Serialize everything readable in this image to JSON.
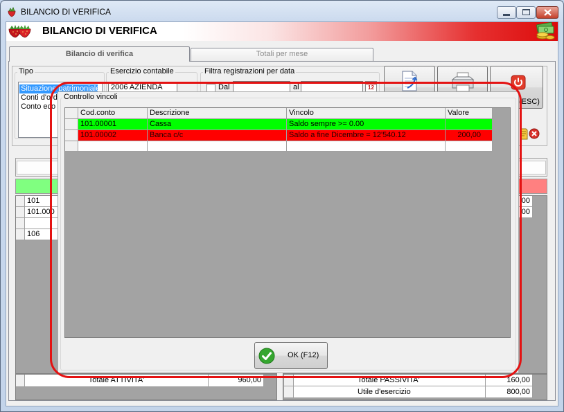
{
  "window": {
    "title": "BILANCIO DI VERIFICA"
  },
  "header": {
    "title": "BILANCIO DI VERIFICA"
  },
  "tabs": [
    {
      "label": "Bilancio di verifica",
      "active": true
    },
    {
      "label": "Totali per mese",
      "active": false
    }
  ],
  "tipo": {
    "label": "Tipo",
    "items": [
      "Situazione patrimoniale",
      "Conti d'ordi",
      "Conto eco"
    ],
    "selected_index": 0
  },
  "esercizio": {
    "label": "Esercizio contabile",
    "value": "2006 AZIENDA"
  },
  "filtro": {
    "label": "Filtra registrazioni per data",
    "dal_label": "Dal",
    "dal_checked": false,
    "dal_value": "",
    "al_label": "al",
    "al_value": "",
    "calendar_day": "12"
  },
  "toolbar": {
    "exit_label": "(ESC)"
  },
  "dialog": {
    "title": "Controllo vincoli",
    "columns": [
      "Cod.conto",
      "Descrizione",
      "Vincolo",
      "Valore"
    ],
    "rows": [
      {
        "cod": "101.00001",
        "desc": "Cassa",
        "vincolo": "Saldo sempre >= 0.00",
        "valore": "",
        "status": "ok"
      },
      {
        "cod": "101.00002",
        "desc": "Banca c/c",
        "vincolo": "Saldo a fine Dicembre = 12'540.12",
        "valore": "200,00",
        "status": "violated"
      }
    ],
    "ok_label": "OK (F12)"
  },
  "grid_left": {
    "rows": [
      "101",
      "101.000",
      "",
      "106"
    ]
  },
  "grid_right": {
    "values": [
      ",00",
      ",00"
    ]
  },
  "totals": {
    "left": {
      "label": "Totale ATTIVITA'",
      "value": "960,00"
    },
    "right": [
      {
        "label": "Totale PASSIVITA'",
        "value": "160,00"
      },
      {
        "label": "Utile d'esercizio",
        "value": "800,00"
      }
    ]
  },
  "colors": {
    "constraint_ok": "#00ff00",
    "constraint_violated": "#ff0000",
    "assets_bar": "#80ff80",
    "liabilities_bar": "#ff8080",
    "selection": "#3399ff",
    "annotation": "#e41212"
  },
  "icons": {
    "app": "strawberry-icon",
    "brand": "strawberries-icon",
    "money": "money-icon",
    "preview": "document-preview-icon",
    "print": "printer-icon",
    "exit": "power-icon",
    "ok": "check-icon",
    "calendar": "calendar-icon",
    "delete": "delete-icon"
  }
}
